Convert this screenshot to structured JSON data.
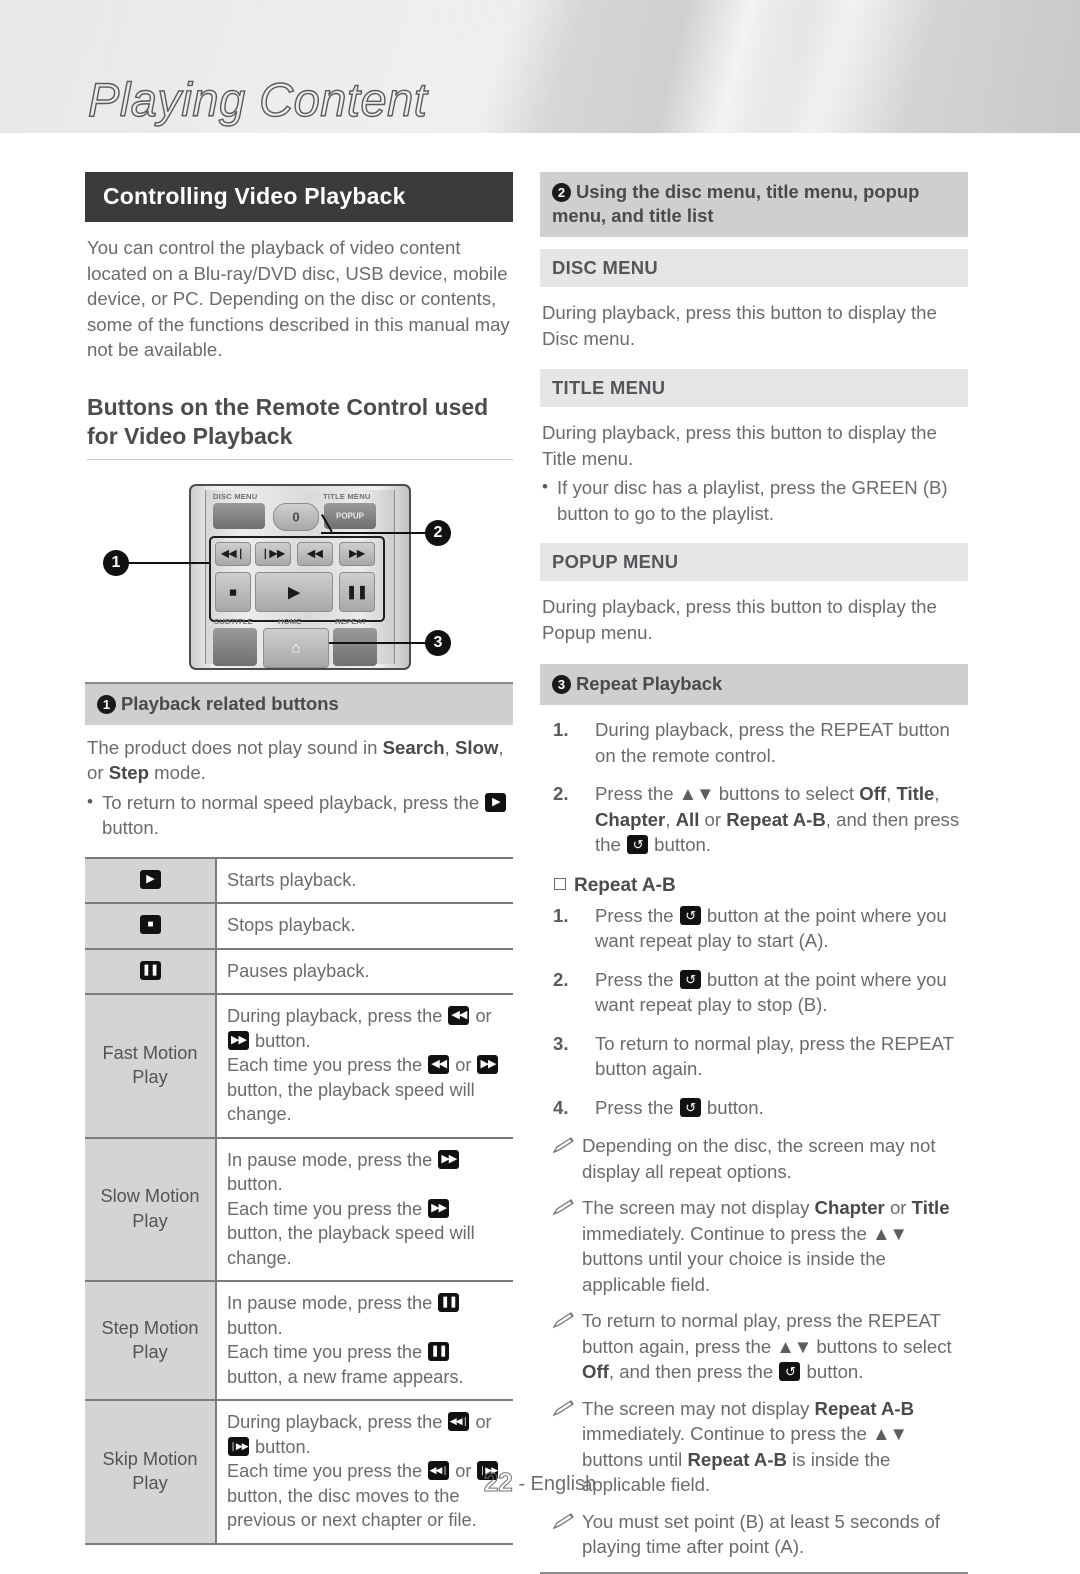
{
  "page": {
    "chapter_title": "Playing Content",
    "footer_page": "22",
    "footer_lang": "- English"
  },
  "left": {
    "section_title": "Controlling Video Playback",
    "intro": "You can control the playback of video content located on a Blu-ray/DVD disc, USB device, mobile device, or PC. Depending on the disc or contents, some of the functions described in this manual may not be available.",
    "subsection_title": "Buttons on the Remote Control used for Video Playback",
    "remote": {
      "label_disc_menu": "DISC MENU",
      "label_title_menu": "TITLE MENU",
      "label_zero": "0",
      "label_popup": "POPUP",
      "label_subtitle": "SUBTITLE",
      "label_home": "HOME",
      "label_repeat": "REPEAT",
      "callout_1": "1",
      "callout_2": "2",
      "callout_3": "3"
    },
    "callout1": {
      "number": "1",
      "heading": "Playback related buttons",
      "para_1": "The product does not play sound in ",
      "para_b1": "Search",
      "para_2": ", ",
      "para_b2": "Slow",
      "para_3": ", or ",
      "para_b3": "Step",
      "para_4": " mode.",
      "bullet_1a": "To return to normal speed playback, press the ",
      "bullet_1b": " button."
    },
    "table": {
      "rows": [
        {
          "key_icon": "play",
          "key_text": "",
          "value": "Starts playback."
        },
        {
          "key_icon": "stop",
          "key_text": "",
          "value": "Stops playback."
        },
        {
          "key_icon": "pause",
          "key_text": "",
          "value": "Pauses playback."
        },
        {
          "key_icon": "",
          "key_text": "Fast Motion Play",
          "v1": "During playback, press the ",
          "v2": " or ",
          "v3": " button.",
          "v4": "Each time you press the ",
          "v5": " or ",
          "v6": " button, the playback speed will change."
        },
        {
          "key_icon": "",
          "key_text": "Slow Motion Play",
          "v1": "In pause mode, press the ",
          "v3": " button.",
          "v4": "Each time you press the ",
          "v6": " button, the playback speed will change."
        },
        {
          "key_icon": "",
          "key_text": "Step Motion Play",
          "v1": "In pause mode, press the ",
          "v3": " button.",
          "v4": "Each time you press the ",
          "v6": " button, a new frame appears."
        },
        {
          "key_icon": "",
          "key_text": "Skip Motion Play",
          "v1": "During playback, press the ",
          "v2": " or ",
          "v3": " button.",
          "v4": "Each time you press the ",
          "v5": " or ",
          "v6": " button, the disc moves to the previous or next chapter or file."
        }
      ]
    }
  },
  "right": {
    "callout2": {
      "number": "2",
      "heading": "Using the disc menu, title menu, popup menu, and title list"
    },
    "disc_menu": {
      "title": "DISC MENU",
      "body": "During playback, press this button to display the Disc menu."
    },
    "title_menu": {
      "title": "TITLE MENU",
      "body": "During playback, press this button to display the Title menu.",
      "bullet_a": "If your disc has a playlist, press the GREEN (B) button to go to the playlist."
    },
    "popup_menu": {
      "title": "POPUP MENU",
      "body": "During playback, press this button to display the Popup menu."
    },
    "callout3": {
      "number": "3",
      "heading": "Repeat Playback"
    },
    "repeat_steps": {
      "s1": "During playback, press the REPEAT button on the remote control.",
      "s2_a": "Press the ",
      "s2_arrows": "▲▼",
      "s2_b": " buttons to select ",
      "s2_off": "Off",
      "s2_c": ", ",
      "s2_title": "Title",
      "s2_d": ", ",
      "s2_chapter": "Chapter",
      "s2_e": ", ",
      "s2_all": "All",
      "s2_f": " or ",
      "s2_ab": "Repeat A-B",
      "s2_g": ", and then press the ",
      "s2_h": " button."
    },
    "repeat_ab": {
      "heading": "Repeat A-B",
      "s1_a": "Press the ",
      "s1_b": " button at the point where you want repeat play to start (A).",
      "s2_a": "Press the ",
      "s2_b": " button at the point where you want repeat play to stop (B).",
      "s3": "To return to normal play, press the REPEAT button again.",
      "s4_a": "Press the ",
      "s4_b": " button."
    },
    "notes": {
      "n1": "Depending on the disc, the screen may not display all repeat options.",
      "n2_a": "The screen may not display ",
      "n2_chapter": "Chapter",
      "n2_b": " or ",
      "n2_title": "Title",
      "n2_c": " immediately. Continue to press the ",
      "n2_arrows": "▲▼",
      "n2_d": " buttons until your choice is inside the applicable field.",
      "n3_a": "To return to normal play, press the REPEAT button again, press the ",
      "n3_arrows": "▲▼",
      "n3_b": " buttons to select ",
      "n3_off": "Off",
      "n3_c": ", and then press the ",
      "n3_d": " button.",
      "n4_a": "The screen may not display ",
      "n4_ab1": "Repeat A-B",
      "n4_b": " immediately. Continue to press the ",
      "n4_arrows": "▲▼",
      "n4_c": " buttons until ",
      "n4_ab2": "Repeat A-B",
      "n4_d": " is inside the applicable field.",
      "n5": "You must set point (B) at least 5 seconds of playing time after point (A)."
    }
  },
  "icons": {
    "play": "▶",
    "stop": "■",
    "pause": "❘❘",
    "rew": "◀◀",
    "ffwd": "▶▶",
    "prev": "◀◀❘",
    "next": "❘▶▶",
    "repeat": "↺"
  }
}
